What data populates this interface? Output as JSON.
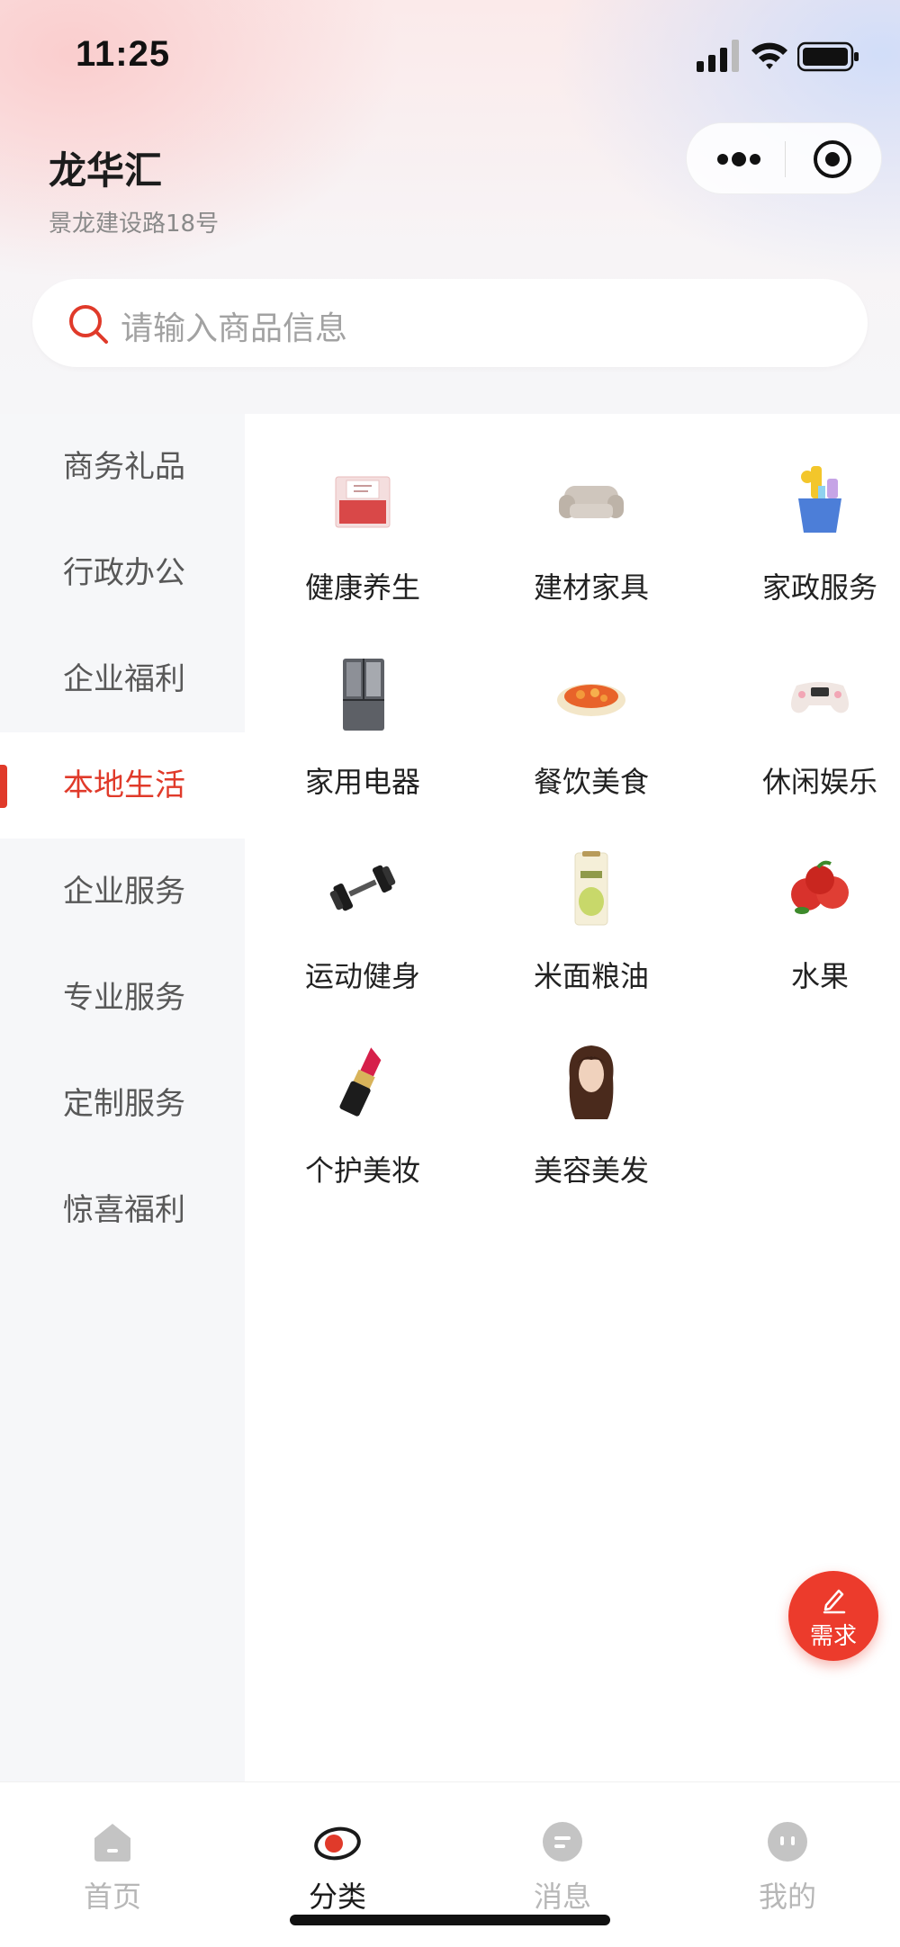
{
  "status": {
    "time": "11:25"
  },
  "header": {
    "shop_name": "龙华汇",
    "address": "景龙建设路18号"
  },
  "search": {
    "placeholder": "请输入商品信息"
  },
  "sidebar": {
    "items": [
      {
        "label": "商务礼品"
      },
      {
        "label": "行政办公"
      },
      {
        "label": "企业福利"
      },
      {
        "label": "本地生活",
        "active": true
      },
      {
        "label": "企业服务"
      },
      {
        "label": "专业服务"
      },
      {
        "label": "定制服务"
      },
      {
        "label": "惊喜福利"
      }
    ]
  },
  "categories": [
    {
      "label": "健康养生",
      "icon": "gift-box-icon"
    },
    {
      "label": "建材家具",
      "icon": "sofa-icon"
    },
    {
      "label": "家政服务",
      "icon": "cleaning-bucket-icon"
    },
    {
      "label": "家用电器",
      "icon": "refrigerator-icon"
    },
    {
      "label": "餐饮美食",
      "icon": "food-plate-icon"
    },
    {
      "label": "休闲娱乐",
      "icon": "game-controller-icon"
    },
    {
      "label": "运动健身",
      "icon": "dumbbell-icon"
    },
    {
      "label": "米面粮油",
      "icon": "rice-bag-icon"
    },
    {
      "label": "水果",
      "icon": "apple-icon"
    },
    {
      "label": "个护美妆",
      "icon": "lipstick-icon"
    },
    {
      "label": "美容美发",
      "icon": "wig-icon"
    }
  ],
  "fab": {
    "label": "需求"
  },
  "tabbar": {
    "items": [
      {
        "label": "首页"
      },
      {
        "label": "分类",
        "active": true
      },
      {
        "label": "消息"
      },
      {
        "label": "我的"
      }
    ]
  },
  "colors": {
    "accent": "#e03a2a",
    "fab": "#ec3b2c",
    "sidebar_bg": "#f6f7f9"
  }
}
